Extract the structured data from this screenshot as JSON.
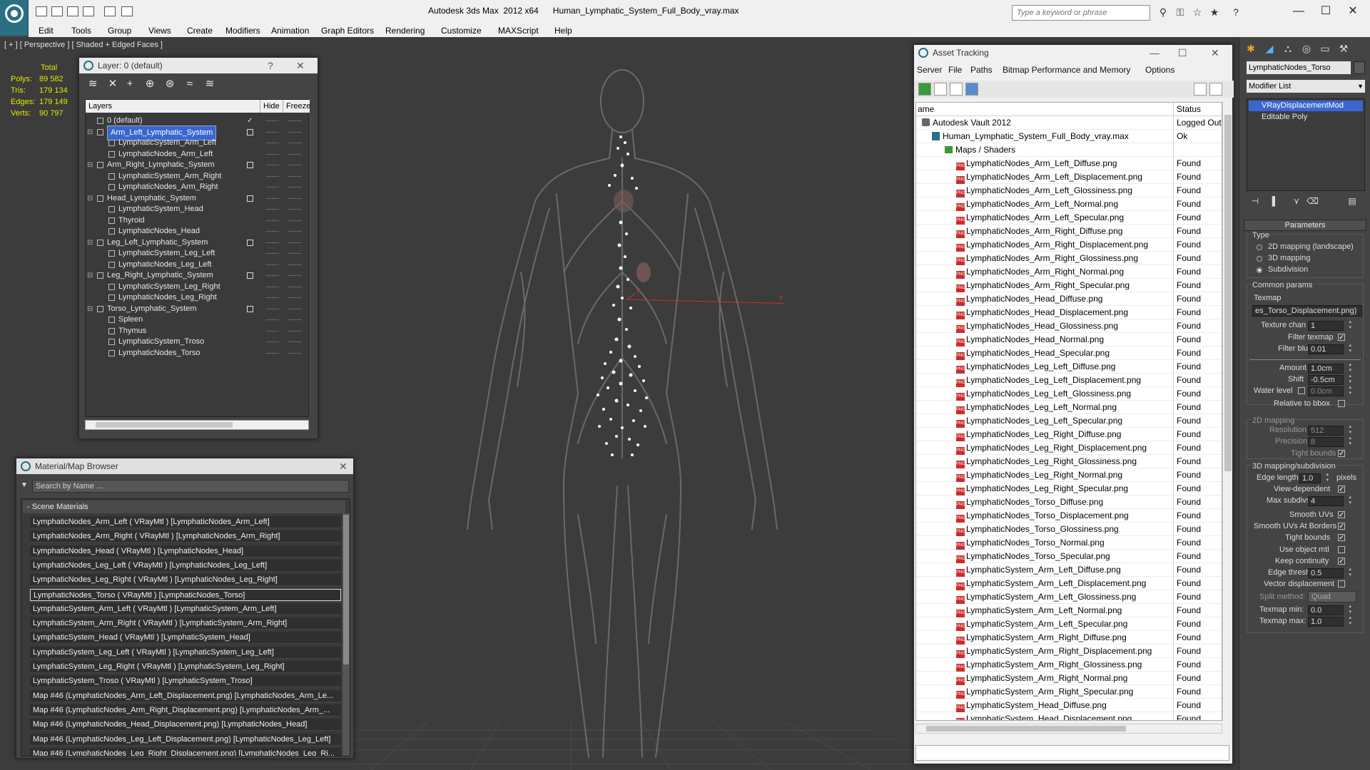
{
  "window": {
    "app_title": "Autodesk 3ds Max  2012 x64",
    "file_name": "Human_Lymphatic_System_Full_Body_vray.max",
    "search_placeholder": "Type a keyword or phrase",
    "min": "—",
    "max": "☐",
    "close": "✕"
  },
  "menu": [
    "Edit",
    "Tools",
    "Group",
    "Views",
    "Create",
    "Modifiers",
    "Animation",
    "Graph Editors",
    "Rendering",
    "Customize",
    "MAXScript",
    "Help"
  ],
  "viewport": {
    "label": "[ + ] [ Perspective ] [ Shaded + Edged Faces ]",
    "stats": {
      "header": "Total",
      "rows": [
        {
          "label": "Polys:",
          "value": "89 582"
        },
        {
          "label": "Tris:",
          "value": "179 134"
        },
        {
          "label": "Edges:",
          "value": "179 149"
        },
        {
          "label": "Verts:",
          "value": "90 797"
        }
      ]
    },
    "axis_x": "x",
    "axis_y": "y"
  },
  "layer_window": {
    "title": "Layer: 0 (default)",
    "help": "?",
    "close": "✕",
    "columns": {
      "layers": "Layers",
      "hide": "Hide",
      "freeze": "Freeze"
    },
    "rows": [
      {
        "name": "0 (default)",
        "level": 0,
        "type": "layer",
        "checked": true
      },
      {
        "name": "Arm_Left_Lymphatic_System",
        "level": 0,
        "type": "layer",
        "selected": true,
        "expanded": true
      },
      {
        "name": "LymphaticSystem_Arm_Left",
        "level": 1,
        "type": "object"
      },
      {
        "name": "LymphaticNodes_Arm_Left",
        "level": 1,
        "type": "object"
      },
      {
        "name": "Arm_Right_Lymphatic_System",
        "level": 0,
        "type": "layer",
        "expanded": true
      },
      {
        "name": "LymphaticSystem_Arm_Right",
        "level": 1,
        "type": "object"
      },
      {
        "name": "LymphaticNodes_Arm_Right",
        "level": 1,
        "type": "object"
      },
      {
        "name": "Head_Lymphatic_System",
        "level": 0,
        "type": "layer",
        "expanded": true
      },
      {
        "name": "LymphaticSystem_Head",
        "level": 1,
        "type": "object"
      },
      {
        "name": "Thyroid",
        "level": 1,
        "type": "object"
      },
      {
        "name": "LymphaticNodes_Head",
        "level": 1,
        "type": "object"
      },
      {
        "name": "Leg_Left_Lymphatic_System",
        "level": 0,
        "type": "layer",
        "expanded": true
      },
      {
        "name": "LymphaticSystem_Leg_Left",
        "level": 1,
        "type": "object"
      },
      {
        "name": "LymphaticNodes_Leg_Left",
        "level": 1,
        "type": "object"
      },
      {
        "name": "Leg_Right_Lymphatic_System",
        "level": 0,
        "type": "layer",
        "expanded": true
      },
      {
        "name": "LymphaticSystem_Leg_Right",
        "level": 1,
        "type": "object"
      },
      {
        "name": "LymphaticNodes_Leg_Right",
        "level": 1,
        "type": "object"
      },
      {
        "name": "Torso_Lymphatic_System",
        "level": 0,
        "type": "layer",
        "expanded": true
      },
      {
        "name": "Spleen",
        "level": 1,
        "type": "object"
      },
      {
        "name": "Thymus",
        "level": 1,
        "type": "object"
      },
      {
        "name": "LymphaticSystem_Troso",
        "level": 1,
        "type": "object"
      },
      {
        "name": "LymphaticNodes_Torso",
        "level": 1,
        "type": "object"
      }
    ]
  },
  "material_browser": {
    "title": "Material/Map Browser",
    "close": "✕",
    "search_placeholder": "Search by Name ...",
    "group": "- Scene Materials",
    "items": [
      "LymphaticNodes_Arm_Left  ( VRayMtl ) [LymphaticNodes_Arm_Left]",
      "LymphaticNodes_Arm_Right  ( VRayMtl ) [LymphaticNodes_Arm_Right]",
      "LymphaticNodes_Head  ( VRayMtl ) [LymphaticNodes_Head]",
      "LymphaticNodes_Leg_Left  ( VRayMtl ) [LymphaticNodes_Leg_Left]",
      "LymphaticNodes_Leg_Right  ( VRayMtl ) [LymphaticNodes_Leg_Right]",
      "LymphaticNodes_Torso  ( VRayMtl ) [LymphaticNodes_Torso]",
      "LymphaticSystem_Arm_Left  ( VRayMtl ) [LymphaticSystem_Arm_Left]",
      "LymphaticSystem_Arm_Right  ( VRayMtl ) [LymphaticSystem_Arm_Right]",
      "LymphaticSystem_Head  ( VRayMtl ) [LymphaticSystem_Head]",
      "LymphaticSystem_Leg_Left  ( VRayMtl ) [LymphaticSystem_Leg_Left]",
      "LymphaticSystem_Leg_Right  ( VRayMtl ) [LymphaticSystem_Leg_Right]",
      "LymphaticSystem_Troso  ( VRayMtl ) [LymphaticSystem_Troso]",
      "Map #46 (LymphaticNodes_Arm_Left_Displacement.png) [LymphaticNodes_Arm_Le...",
      "Map #46 (LymphaticNodes_Arm_Right_Displacement.png) [LymphaticNodes_Arm_...",
      "Map #46 (LymphaticNodes_Head_Displacement.png) [LymphaticNodes_Head]",
      "Map #46 (LymphaticNodes_Leg_Left_Displacement.png) [LymphaticNodes_Leg_Left]",
      "Map #46 (LymphaticNodes_Leg_Right_Displacement.png) [LymphaticNodes_Leg_Ri..."
    ],
    "selected_index": 5
  },
  "asset_tracking": {
    "title": "Asset Tracking",
    "min": "—",
    "max": "☐",
    "close": "✕",
    "menu": [
      "Server",
      "File",
      "Paths",
      "Bitmap Performance and Memory",
      "Options"
    ],
    "columns": {
      "name": "ame",
      "status": "Status"
    },
    "root": {
      "name": "Autodesk Vault 2012",
      "status": "Logged Out"
    },
    "file": {
      "name": "Human_Lymphatic_System_Full_Body_vray.max",
      "status": "Ok"
    },
    "folder": {
      "name": "Maps / Shaders",
      "status": ""
    },
    "png_label": "PNG",
    "maps": [
      "LymphaticNodes_Arm_Left_Diffuse.png",
      "LymphaticNodes_Arm_Left_Displacement.png",
      "LymphaticNodes_Arm_Left_Glossiness.png",
      "LymphaticNodes_Arm_Left_Normal.png",
      "LymphaticNodes_Arm_Left_Specular.png",
      "LymphaticNodes_Arm_Right_Diffuse.png",
      "LymphaticNodes_Arm_Right_Displacement.png",
      "LymphaticNodes_Arm_Right_Glossiness.png",
      "LymphaticNodes_Arm_Right_Normal.png",
      "LymphaticNodes_Arm_Right_Specular.png",
      "LymphaticNodes_Head_Diffuse.png",
      "LymphaticNodes_Head_Displacement.png",
      "LymphaticNodes_Head_Glossiness.png",
      "LymphaticNodes_Head_Normal.png",
      "LymphaticNodes_Head_Specular.png",
      "LymphaticNodes_Leg_Left_Diffuse.png",
      "LymphaticNodes_Leg_Left_Displacement.png",
      "LymphaticNodes_Leg_Left_Glossiness.png",
      "LymphaticNodes_Leg_Left_Normal.png",
      "LymphaticNodes_Leg_Left_Specular.png",
      "LymphaticNodes_Leg_Right_Diffuse.png",
      "LymphaticNodes_Leg_Right_Displacement.png",
      "LymphaticNodes_Leg_Right_Glossiness.png",
      "LymphaticNodes_Leg_Right_Normal.png",
      "LymphaticNodes_Leg_Right_Specular.png",
      "LymphaticNodes_Torso_Diffuse.png",
      "LymphaticNodes_Torso_Displacement.png",
      "LymphaticNodes_Torso_Glossiness.png",
      "LymphaticNodes_Torso_Normal.png",
      "LymphaticNodes_Torso_Specular.png",
      "LymphaticSystem_Arm_Left_Diffuse.png",
      "LymphaticSystem_Arm_Left_Displacement.png",
      "LymphaticSystem_Arm_Left_Glossiness.png",
      "LymphaticSystem_Arm_Left_Normal.png",
      "LymphaticSystem_Arm_Left_Specular.png",
      "LymphaticSystem_Arm_Right_Diffuse.png",
      "LymphaticSystem_Arm_Right_Displacement.png",
      "LymphaticSystem_Arm_Right_Glossiness.png",
      "LymphaticSystem_Arm_Right_Normal.png",
      "LymphaticSystem_Arm_Right_Specular.png",
      "LymphaticSystem_Head_Diffuse.png",
      "LymphaticSystem_Head_Displacement.png"
    ],
    "map_status": "Found"
  },
  "command_panel": {
    "object_name": "LymphaticNodes_Torso",
    "modifier_list": "Modifier List",
    "stack": [
      "VRayDisplacementMod",
      "Editable Poly"
    ],
    "rollout": "Parameters",
    "type_label": "Type",
    "type_options": [
      "2D mapping (landscape)",
      "3D mapping",
      "Subdivision"
    ],
    "type_selected": 2,
    "common_params": "Common params",
    "texmap_label": "Texmap",
    "texmap_value": "es_Torso_Displacement.png)",
    "texture_chan_label": "Texture chan",
    "texture_chan": "1",
    "filter_texmap": "Filter texmap",
    "filter_blur_label": "Filter blur",
    "filter_blur": "0.01",
    "amount_label": "Amount",
    "amount": "1.0cm",
    "shift_label": "Shift",
    "shift": "-0.5cm",
    "water_level_label": "Water level",
    "water_level": "0.0cm",
    "relative_bbox": "Relative to bbox",
    "mapping_2d": "2D mapping",
    "resolution_label": "Resolution",
    "resolution": "512",
    "precision_label": "Precision",
    "precision": "8",
    "tight_bounds_2d": "Tight bounds",
    "mapping_3d": "3D mapping/subdivision",
    "edge_length_label": "Edge length",
    "edge_length": "1.0",
    "pixels": "pixels",
    "view_dependent": "View-dependent",
    "max_subdivs_label": "Max subdivs",
    "max_subdivs": "4",
    "smooth_uvs": "Smooth UVs",
    "smooth_uvs_borders": "Smooth UVs At Borders",
    "tight_bounds": "Tight bounds",
    "use_object_mtl": "Use object mtl",
    "keep_continuity": "Keep continuity",
    "edge_thresh_label": "Edge thresh",
    "edge_thresh": "0.5",
    "vector_displacement": "Vector displacement",
    "split_method_label": "Split method:",
    "split_method": "Quad",
    "texmap_min_label": "Texmap min:",
    "texmap_min": "0.0",
    "texmap_max_label": "Texmap max:",
    "texmap_max": "1.0"
  },
  "colors": {
    "accent": "#2b6f83",
    "selection": "#3a66cf",
    "stats_text": "#e6e600",
    "lymph_node": "#ffffff",
    "vessel": "#6a6a6a",
    "axis_x": "#c83232"
  }
}
